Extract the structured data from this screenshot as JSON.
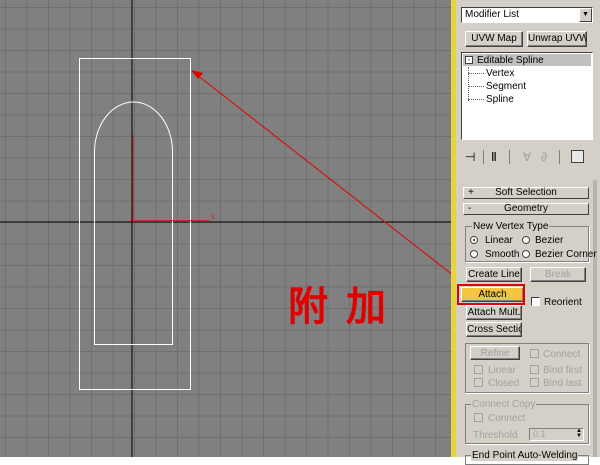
{
  "annotation": {
    "text": "附加",
    "color": "#e00000"
  },
  "panel": {
    "modifier_list": "Modifier List",
    "buttons": {
      "uvw_map": "UVW Map",
      "unwrap_uvw": "Unwrap UVW"
    },
    "stack": {
      "root": "Editable Spline",
      "children": [
        "Vertex",
        "Segment",
        "Spline"
      ]
    },
    "rollouts": {
      "soft_selection": {
        "sign": "+",
        "title": "Soft Selection"
      },
      "geometry": {
        "sign": "-",
        "title": "Geometry"
      }
    },
    "new_vertex_type": {
      "label": "New Vertex Type",
      "options": [
        "Linear",
        "Bezier",
        "Smooth",
        "Bezier Corner"
      ],
      "selected": "Linear"
    },
    "geometry_buttons": {
      "create_line": "Create Line",
      "break": "Break",
      "attach": "Attach",
      "reorient": "Reorient",
      "attach_mult": "Attach Mult.",
      "cross_section": "Cross Section",
      "refine": "Refine",
      "connect": "Connect",
      "linear": "Linear",
      "bind_first": "Bind first",
      "closed": "Closed",
      "bind_last": "Bind last"
    },
    "connect_copy": {
      "label": "Connect Copy",
      "connect": "Connect",
      "threshold_label": "Threshold",
      "threshold_value": "0.1"
    },
    "end_point": "End Point Auto-Welding"
  },
  "colors": {
    "viewport_bg": "#808080",
    "grid": "#6f6f6f",
    "spline": "#ffffff",
    "accent_border": "#e6d63c",
    "highlight": "#f5c542",
    "annotation": "#e00000"
  }
}
